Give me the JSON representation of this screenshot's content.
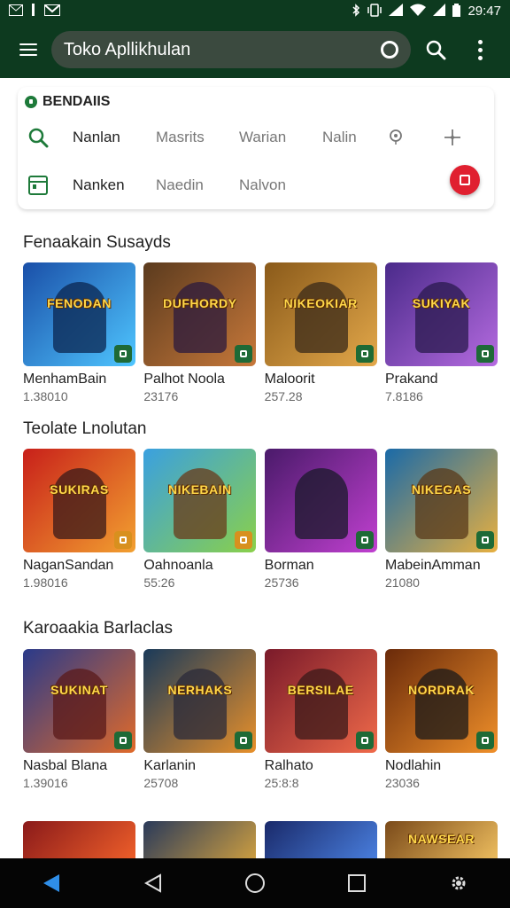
{
  "status_bar": {
    "time": "29:47",
    "left_icons": [
      "mail-icon",
      "bell-icon",
      "gmail-icon"
    ],
    "right_icons": [
      "bluetooth-icon",
      "vibrate-icon",
      "signal-icon",
      "wifi-icon",
      "signal-icon-2",
      "battery-icon"
    ]
  },
  "app_bar": {
    "search_text": "Toko Apllikhulan"
  },
  "filter": {
    "title": "BENDAIIS",
    "row1": [
      "Nanlan",
      "Masrits",
      "Warian",
      "Nalin"
    ],
    "row2": [
      "Nanken",
      "Naedin",
      "Nalvon"
    ]
  },
  "sections": [
    {
      "title": "Fenaakain Susayds",
      "apps": [
        {
          "name": "MenhamBain",
          "meta": "1.38010",
          "logo": "FENODAN",
          "c1": "#1a4fa8",
          "c2": "#4fc6ff",
          "hero": "#0b2550",
          "badge": "green"
        },
        {
          "name": "Palhot Noola",
          "meta": "23176",
          "logo": "DUFHORDY",
          "c1": "#5b3b1e",
          "c2": "#c7783a",
          "hero": "#2b1a3e",
          "badge": "green"
        },
        {
          "name": "Maloorit",
          "meta": "257.28",
          "logo": "NIKEOKIAR",
          "c1": "#8a5a1a",
          "c2": "#e3a84a",
          "hero": "#3a2a1a",
          "badge": "green"
        },
        {
          "name": "Prakand",
          "meta": "7.8186",
          "logo": "SUKIYAK",
          "c1": "#4a2a8a",
          "c2": "#b56be0",
          "hero": "#2a1a4e",
          "badge": "green"
        }
      ]
    },
    {
      "title": "Teolate Lnolutan",
      "apps": [
        {
          "name": "NaganSandan",
          "meta": "1.98016",
          "logo": "SUKIRAS",
          "c1": "#c8201a",
          "c2": "#f2a030",
          "hero": "#3a1a1a",
          "badge": "orange"
        },
        {
          "name": "Oahnoanla",
          "meta": "55:26",
          "logo": "NIKEBAIN",
          "c1": "#3aa0e0",
          "c2": "#8ad04a",
          "hero": "#6a3a1a",
          "badge": "orange"
        },
        {
          "name": "Borman",
          "meta": "25736",
          "logo": "",
          "c1": "#4a1a6a",
          "c2": "#c040d0",
          "hero": "#1a1a2a",
          "badge": "green"
        },
        {
          "name": "MabeinAmman",
          "meta": "21080",
          "logo": "NIKEGAS",
          "c1": "#1a6aa8",
          "c2": "#e8b040",
          "hero": "#5a3a1a",
          "badge": "green"
        }
      ]
    },
    {
      "title": "Karoaakia Barlaclas",
      "apps": [
        {
          "name": "Nasbal Blana",
          "meta": "1.39016",
          "logo": "SUKINAT",
          "c1": "#2a3a8a",
          "c2": "#e06a2a",
          "hero": "#5a1a1a",
          "badge": "green"
        },
        {
          "name": "Karlanin",
          "meta": "25708",
          "logo": "NERHAKS",
          "c1": "#1a3a5a",
          "c2": "#e8902a",
          "hero": "#2a2a3a",
          "badge": "green"
        },
        {
          "name": "Ralhato",
          "meta": "25:8:8",
          "logo": "BERSILAE",
          "c1": "#7a1a2a",
          "c2": "#f06a4a",
          "hero": "#3a1a1a",
          "badge": "green"
        },
        {
          "name": "Nodlahin",
          "meta": "23036",
          "logo": "NORDRAK",
          "c1": "#6a2a0a",
          "c2": "#f0902a",
          "hero": "#1a1a1a",
          "badge": "green"
        }
      ]
    }
  ],
  "partial_row": [
    {
      "c1": "#8a1a1a",
      "c2": "#f0602a"
    },
    {
      "c1": "#2a3a5a",
      "c2": "#d0a040"
    },
    {
      "c1": "#1a2a6a",
      "c2": "#4a80e0"
    },
    {
      "c1": "#7a4a1a",
      "c2": "#f0c060",
      "logo": "NAWSEAR"
    }
  ],
  "colors": {
    "app_bar": "#0d3a1f",
    "accent_green": "#1e7a3a",
    "fab_red": "#e02030"
  }
}
